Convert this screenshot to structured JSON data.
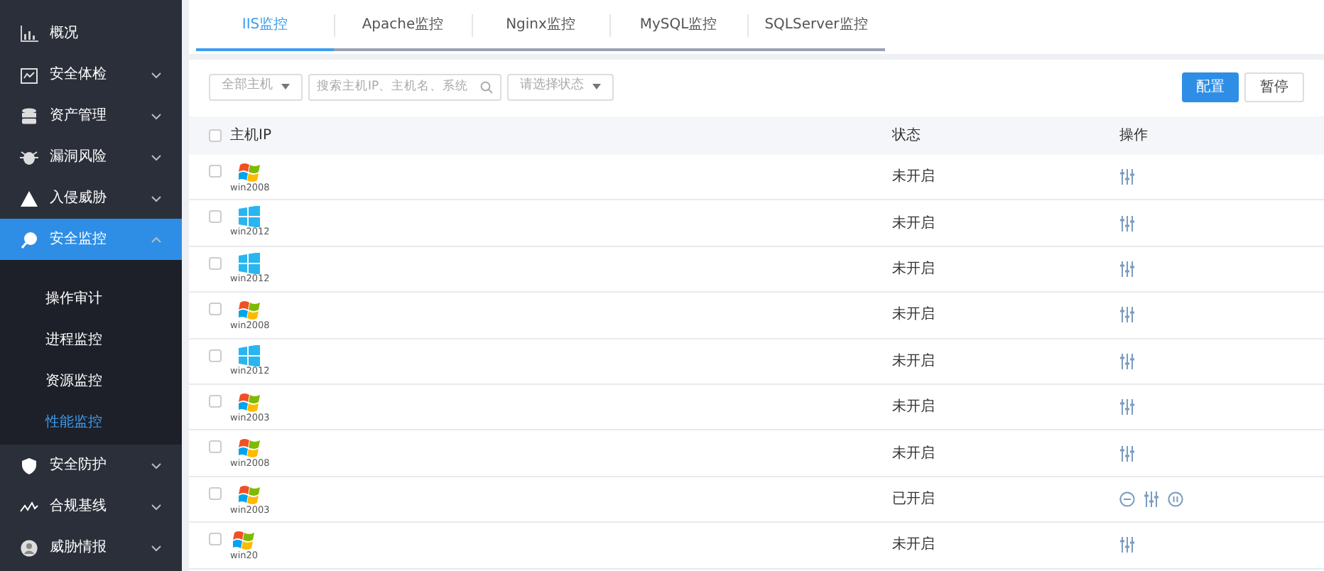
{
  "sidebar": {
    "items": [
      {
        "label": "概况",
        "selected": false
      },
      {
        "label": "安全体检",
        "expanded": false,
        "selected": false
      },
      {
        "label": "资产管理",
        "expanded": false,
        "selected": false
      },
      {
        "label": "漏洞风险",
        "expanded": false,
        "selected": false
      },
      {
        "label": "入侵威胁",
        "expanded": false,
        "selected": false
      },
      {
        "label": "安全监控",
        "expanded": true,
        "selected": true,
        "children": [
          {
            "label": "操作审计",
            "selected": false
          },
          {
            "label": "进程监控",
            "selected": false
          },
          {
            "label": "资源监控",
            "selected": false
          },
          {
            "label": "性能监控",
            "selected": true
          }
        ]
      },
      {
        "label": "安全防护",
        "expanded": false,
        "selected": false
      },
      {
        "label": "合规基线",
        "expanded": false,
        "selected": false
      },
      {
        "label": "威胁情报",
        "expanded": false,
        "selected": false
      }
    ]
  },
  "tabs": [
    {
      "label": "IIS监控",
      "selected": true
    },
    {
      "label": "Apache监控",
      "selected": false
    },
    {
      "label": "Nginx监控",
      "selected": false
    },
    {
      "label": "MySQL监控",
      "selected": false
    },
    {
      "label": "SQLServer监控",
      "selected": false
    }
  ],
  "filters": {
    "host_group": "全部主机",
    "search": {
      "placeholder": "搜索主机IP、主机名、系统"
    },
    "status": "请选择状态"
  },
  "buttons": [
    {
      "label": "配置",
      "kind": "primary"
    },
    {
      "label": "暂停",
      "kind": "default"
    }
  ],
  "table": {
    "columns": [
      "主机IP",
      "状态",
      "操作"
    ],
    "header_checked": false,
    "rows": [
      {
        "checked": false,
        "os": "win2008",
        "kind": "flag",
        "status": "未开启",
        "enabled": false
      },
      {
        "checked": false,
        "os": "win2012",
        "kind": "tiles",
        "status": "未开启",
        "enabled": false
      },
      {
        "checked": false,
        "os": "win2012",
        "kind": "tiles",
        "status": "未开启",
        "enabled": false
      },
      {
        "checked": false,
        "os": "win2008",
        "kind": "flag",
        "status": "未开启",
        "enabled": false
      },
      {
        "checked": false,
        "os": "win2012",
        "kind": "tiles",
        "status": "未开启",
        "enabled": false
      },
      {
        "checked": false,
        "os": "win2003",
        "kind": "flag",
        "status": "未开启",
        "enabled": false
      },
      {
        "checked": false,
        "os": "win2008",
        "kind": "flag",
        "status": "未开启",
        "enabled": false
      },
      {
        "checked": false,
        "os": "win2003",
        "kind": "flag",
        "status": "已开启",
        "enabled": true
      },
      {
        "checked": false,
        "os": "win20",
        "kind": "flag",
        "status": "未开启",
        "enabled": false
      }
    ]
  }
}
